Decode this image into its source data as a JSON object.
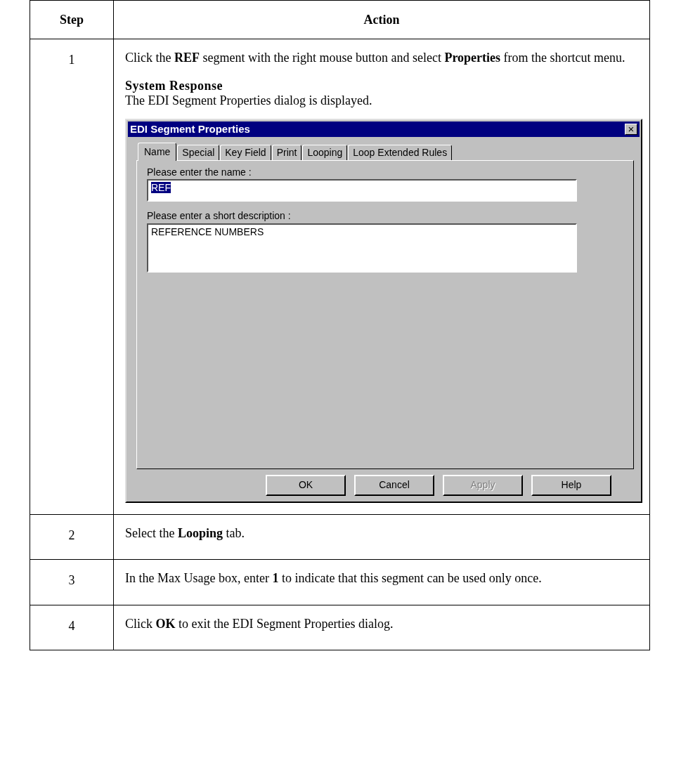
{
  "table": {
    "columns": [
      "Step",
      "Action"
    ],
    "rows": [
      {
        "step": "1",
        "paragraphs": [
          "Click the **REF** segment with the right mouse button and select **Properties** from the shortcut menu."
        ],
        "response_heading": "System Response",
        "response_text": "The EDI Segment Properties dialog is displayed.",
        "dialog": {
          "title": "EDI Segment Properties",
          "close": "×",
          "tabs": [
            {
              "label": "Name",
              "selected": true
            },
            {
              "label": "Special",
              "selected": false
            },
            {
              "label": "Key Field",
              "selected": false
            },
            {
              "label": "Print",
              "selected": false
            },
            {
              "label": "Looping",
              "selected": false
            },
            {
              "label": "Loop Extended Rules",
              "selected": false
            }
          ],
          "name_label": "Please enter the name :",
          "name_value": "REF",
          "name_value_selected": true,
          "description_label": "Please enter a short description :",
          "description_value": "REFERENCE NUMBERS",
          "buttons": [
            {
              "label": "OK",
              "disabled": false
            },
            {
              "label": "Cancel",
              "disabled": false
            },
            {
              "label": "Apply",
              "disabled": true
            },
            {
              "label": "Help",
              "disabled": false
            }
          ]
        }
      },
      {
        "step": "2",
        "paragraphs": [
          "Select the **Looping** tab."
        ]
      },
      {
        "step": "3",
        "paragraphs": [
          "In the Max Usage box, enter **1** to indicate that this segment can be used only once."
        ]
      },
      {
        "step": "4",
        "paragraphs": [
          "Click **OK** to exit the EDI Segment Properties dialog."
        ]
      }
    ]
  }
}
